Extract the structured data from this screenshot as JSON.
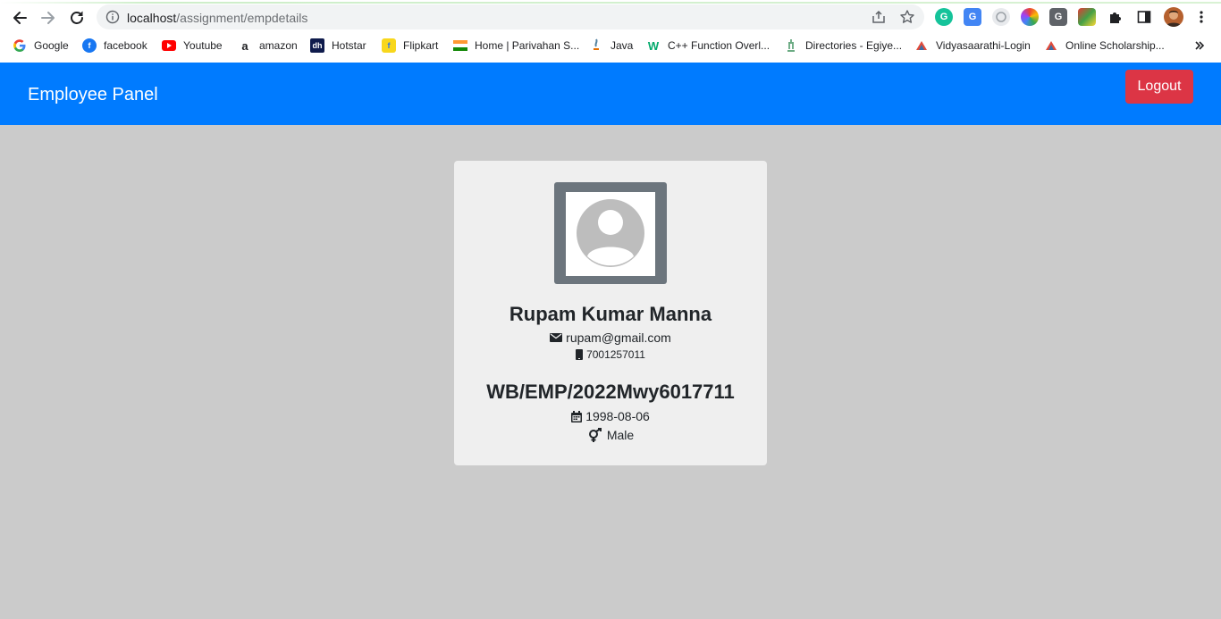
{
  "browser": {
    "url_host": "localhost",
    "url_path": "/assignment/empdetails",
    "bookmarks": [
      {
        "label": "Google",
        "icon": "google-icon",
        "color": "#4285f4"
      },
      {
        "label": "facebook",
        "icon": "facebook-icon",
        "color": "#1877f2"
      },
      {
        "label": "Youtube",
        "icon": "youtube-icon",
        "color": "#ff0000"
      },
      {
        "label": "amazon",
        "icon": "amazon-icon",
        "color": "#ff9900"
      },
      {
        "label": "Hotstar",
        "icon": "hotstar-icon",
        "color": "#0f1b4c"
      },
      {
        "label": "Flipkart",
        "icon": "flipkart-icon",
        "color": "#f8d71c"
      },
      {
        "label": "Home | Parivahan S...",
        "icon": "india-flag-icon",
        "color": "#ff9933"
      },
      {
        "label": "Java",
        "icon": "java-icon",
        "color": "#5382a1"
      },
      {
        "label": "C++ Function Overl...",
        "icon": "w3schools-icon",
        "color": "#04aa6d"
      },
      {
        "label": "Directories - Egiye...",
        "icon": "emblem-icon",
        "color": "#3a8f5a"
      },
      {
        "label": "Vidyasaarathi-Login",
        "icon": "vidyasaarathi-icon",
        "color": "#e14b3b"
      },
      {
        "label": "Online Scholarship...",
        "icon": "scholarship-icon",
        "color": "#e14b3b"
      }
    ]
  },
  "header": {
    "brand": "Employee Panel",
    "logout_label": "Logout",
    "bg_color": "#007bff",
    "logout_color": "#dc3545"
  },
  "profile": {
    "name": "Rupam Kumar Manna",
    "email": "rupam@gmail.com",
    "phone": "7001257011",
    "employee_id": "WB/EMP/2022Mwy6017711",
    "dob": "1998-08-06",
    "gender": "Male"
  }
}
